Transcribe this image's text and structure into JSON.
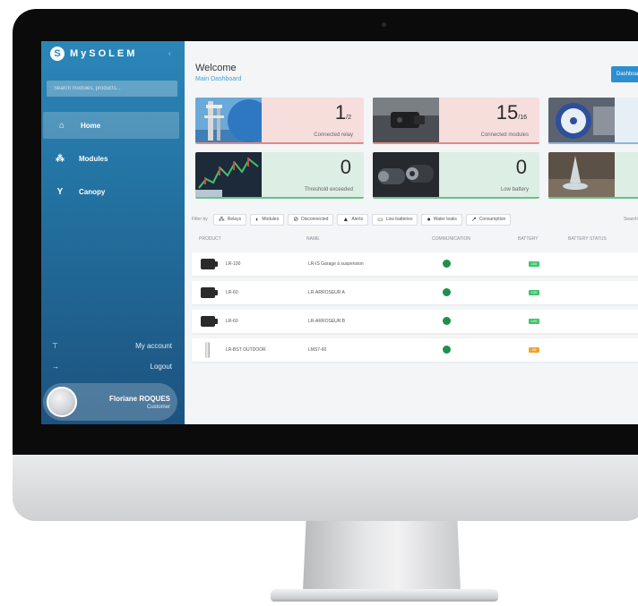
{
  "app": {
    "logo_mark": "S",
    "logo_text": "MySOLEM",
    "collapse_icon": "chevron-icon",
    "search_placeholder": "Search modules, products..."
  },
  "sidebar": {
    "items": [
      {
        "label": "Home",
        "icon": "home-icon",
        "glyph": "⌂",
        "active": true
      },
      {
        "label": "Modules",
        "icon": "modules-icon",
        "glyph": "⁂",
        "active": false
      },
      {
        "label": "Canopy",
        "icon": "canopy-icon",
        "glyph": "Y",
        "active": false
      }
    ],
    "account": [
      {
        "label": "My account",
        "icon": "tap-icon",
        "glyph": "⊤"
      },
      {
        "label": "Logout",
        "icon": "logout-arrow-icon",
        "glyph": "→"
      }
    ],
    "user": {
      "name": "Floriane ROQUES",
      "role": "Customer"
    }
  },
  "header": {
    "title": "Welcome",
    "subtitle": "Main Dashboard",
    "dashboard_button": "Dashboard"
  },
  "cards": [
    {
      "value": "1",
      "sub": "/2",
      "label": "Connected relay",
      "color": "red",
      "image": "relay-antenna"
    },
    {
      "value": "15",
      "sub": "/16",
      "label": "Connected modules",
      "color": "red",
      "image": "module-device"
    },
    {
      "value": "",
      "sub": "",
      "label": "",
      "color": "blue",
      "image": "water-meter"
    },
    {
      "value": "0",
      "sub": "",
      "label": "Threshold exceeded",
      "color": "green",
      "image": "stock-chart"
    },
    {
      "value": "0",
      "sub": "",
      "label": "Low battery",
      "color": "green",
      "image": "batteries"
    },
    {
      "value": "",
      "sub": "",
      "label": "",
      "color": "green",
      "image": "water-leak"
    }
  ],
  "filters": {
    "label": "Filter by",
    "chips": [
      {
        "label": "Relays",
        "icon": "relay-icon",
        "glyph": "⁂"
      },
      {
        "label": "Modules",
        "icon": "module-icon",
        "glyph": "◐"
      },
      {
        "label": "Disconnected",
        "icon": "disconnected-icon",
        "glyph": "⊘"
      },
      {
        "label": "Alerts",
        "icon": "alert-icon",
        "glyph": "▲"
      },
      {
        "label": "Low batteries",
        "icon": "battery-icon",
        "glyph": "▭"
      },
      {
        "label": "Water leaks",
        "icon": "drop-icon",
        "glyph": "●"
      },
      {
        "label": "Consumption",
        "icon": "consumption-icon",
        "glyph": "↗"
      }
    ],
    "right_label": "Search"
  },
  "table": {
    "columns": [
      "PRODUCT",
      "NAME",
      "COMMUNICATION",
      "BATTERY",
      "BATTERY STATUS"
    ],
    "rows": [
      {
        "product": "LR-100",
        "name": "LR-IS Garage à suspension",
        "device": "module",
        "battery_color": "#3ec46a",
        "battery": "100"
      },
      {
        "product": "LR-60",
        "name": "LR-ARROSEUR A",
        "device": "module",
        "battery_color": "#3ec46a",
        "battery": "100"
      },
      {
        "product": "LR-60",
        "name": "LR-ARROSEUR B",
        "device": "module",
        "battery_color": "#3ec46a",
        "battery": "100"
      },
      {
        "product": "LR-BST OUTDOOR",
        "name": "LMS7-60",
        "device": "pole",
        "battery_color": "#f0a531",
        "battery": "20"
      }
    ]
  },
  "colors": {
    "sidebar_top": "#2b87b8",
    "sidebar_bottom": "#1d527f",
    "accent": "#4aa0cc",
    "connected": "#1f8f4b"
  }
}
